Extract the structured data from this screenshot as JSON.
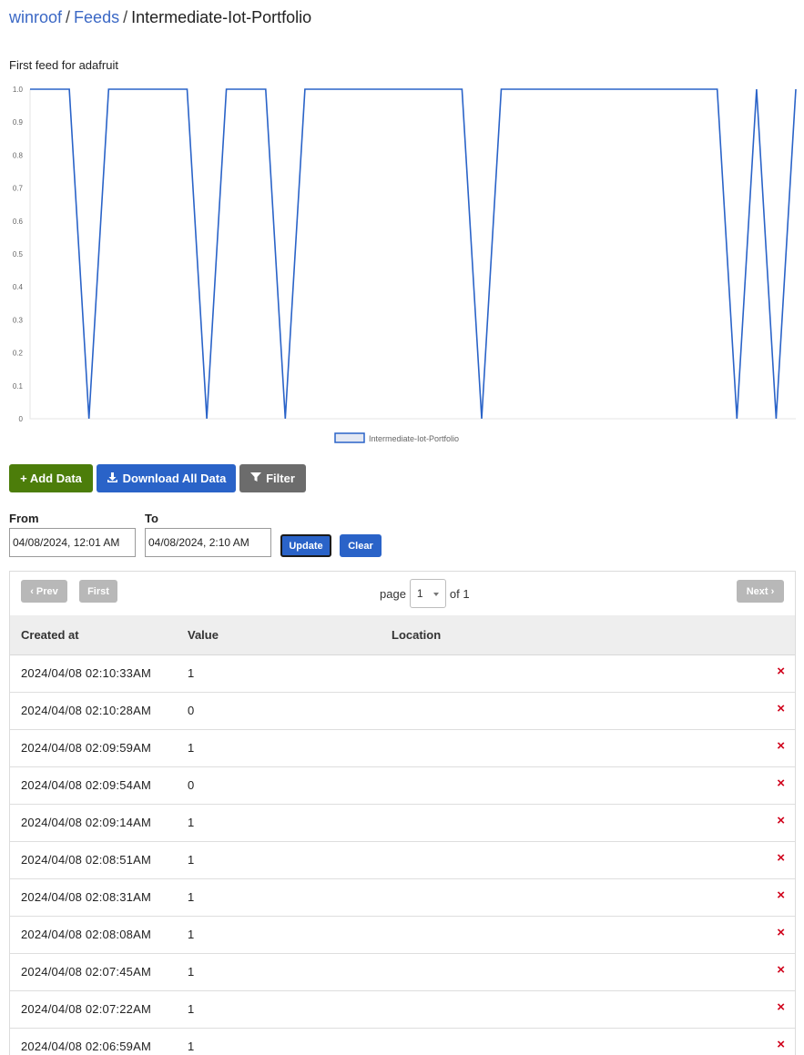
{
  "breadcrumb": {
    "user": "winroof",
    "feeds": "Feeds",
    "current": "Intermediate-Iot-Portfolio",
    "separator": "/"
  },
  "feed_description": "First feed for adafruit",
  "chart_data": {
    "type": "line",
    "title": "",
    "xlabel": "",
    "ylabel": "",
    "ylim": [
      0,
      1
    ],
    "yticks": [
      "0",
      "0.1",
      "0.2",
      "0.3",
      "0.4",
      "0.5",
      "0.6",
      "0.7",
      "0.8",
      "0.9",
      "1.0"
    ],
    "series": [
      {
        "name": "Intermediate-Iot-Portfolio",
        "color": "#2a63c8",
        "values": [
          1,
          1,
          1,
          0,
          1,
          1,
          1,
          1,
          1,
          0,
          1,
          1,
          1,
          0,
          1,
          1,
          1,
          1,
          1,
          1,
          1,
          1,
          1,
          0,
          1,
          1,
          1,
          1,
          1,
          1,
          1,
          1,
          1,
          1,
          1,
          1,
          0,
          1,
          0,
          1
        ]
      }
    ],
    "grid": false,
    "legend": "bottom-center"
  },
  "toolbar": {
    "add_label": "+ Add Data",
    "download_label": "Download All Data",
    "filter_label": "Filter"
  },
  "date_filter": {
    "from_label": "From",
    "from_value": "04/08/2024, 12:01 AM",
    "to_label": "To",
    "to_value": "04/08/2024, 2:10 AM",
    "update_label": "Update",
    "clear_label": "Clear"
  },
  "pager": {
    "prev_label": "Prev",
    "first_label": "First",
    "next_label": "Next",
    "page_word": "page",
    "page_value": "1",
    "of_text": "of 1"
  },
  "table": {
    "headers": [
      "Created at",
      "Value",
      "Location"
    ],
    "rows": [
      {
        "created": "2024/04/08 02:10:33AM",
        "value": "1",
        "location": ""
      },
      {
        "created": "2024/04/08 02:10:28AM",
        "value": "0",
        "location": ""
      },
      {
        "created": "2024/04/08 02:09:59AM",
        "value": "1",
        "location": ""
      },
      {
        "created": "2024/04/08 02:09:54AM",
        "value": "0",
        "location": ""
      },
      {
        "created": "2024/04/08 02:09:14AM",
        "value": "1",
        "location": ""
      },
      {
        "created": "2024/04/08 02:08:51AM",
        "value": "1",
        "location": ""
      },
      {
        "created": "2024/04/08 02:08:31AM",
        "value": "1",
        "location": ""
      },
      {
        "created": "2024/04/08 02:08:08AM",
        "value": "1",
        "location": ""
      },
      {
        "created": "2024/04/08 02:07:45AM",
        "value": "1",
        "location": ""
      },
      {
        "created": "2024/04/08 02:07:22AM",
        "value": "1",
        "location": ""
      },
      {
        "created": "2024/04/08 02:06:59AM",
        "value": "1",
        "location": ""
      }
    ],
    "delete_icon": "×"
  }
}
